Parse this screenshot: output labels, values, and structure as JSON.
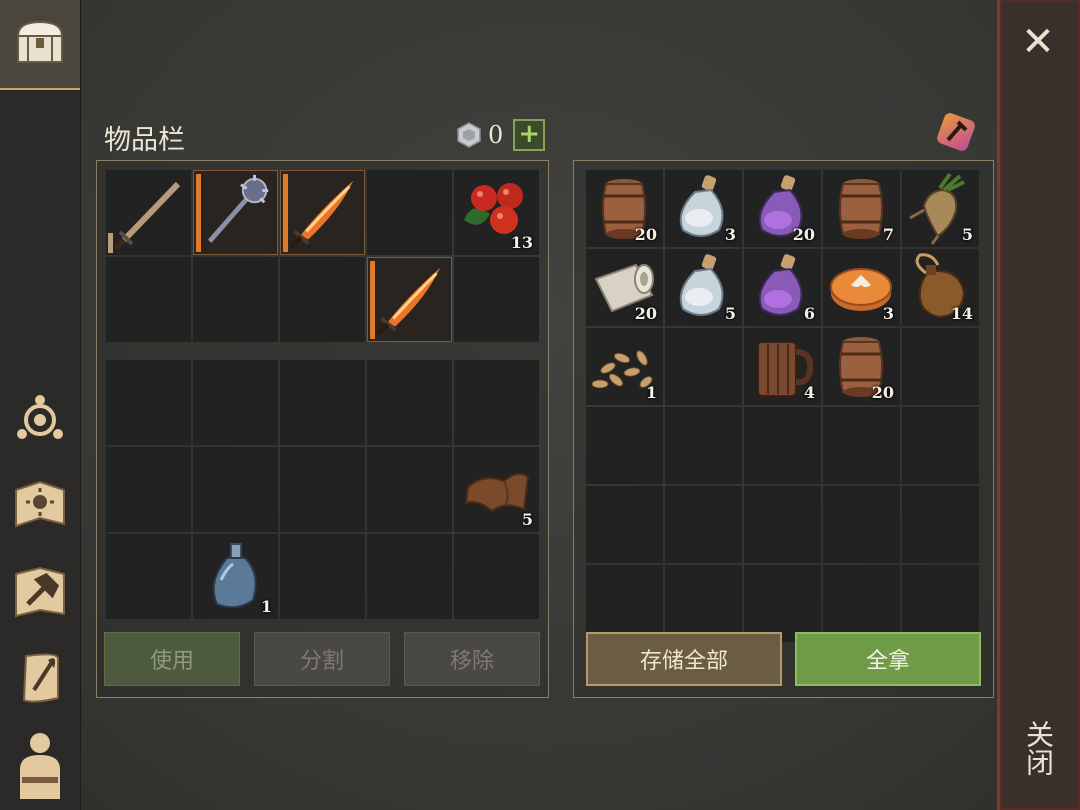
{
  "sidebar": {
    "items": [
      {
        "icon": "chest-icon"
      },
      {
        "icon": "skills-icon"
      },
      {
        "icon": "map-icon"
      },
      {
        "icon": "crafting-icon"
      },
      {
        "icon": "quest-scroll-icon"
      },
      {
        "icon": "character-icon"
      }
    ]
  },
  "close": {
    "label": "关闭",
    "x": "✕"
  },
  "inventory": {
    "title": "物品栏",
    "currency_value": "0",
    "plus_label": "+",
    "equipped": [
      {
        "item": "sword-wood",
        "count": ""
      },
      {
        "item": "mace-steel",
        "count": ""
      },
      {
        "item": "sword-flame",
        "count": ""
      },
      {
        "item": "",
        "count": ""
      },
      {
        "item": "berries",
        "count": "13"
      },
      {
        "item": "",
        "count": ""
      },
      {
        "item": "",
        "count": ""
      },
      {
        "item": "",
        "count": ""
      },
      {
        "item": "sword-flame",
        "count": ""
      },
      {
        "item": "",
        "count": ""
      }
    ],
    "backpack": [
      {
        "item": "",
        "count": ""
      },
      {
        "item": "",
        "count": ""
      },
      {
        "item": "",
        "count": ""
      },
      {
        "item": "",
        "count": ""
      },
      {
        "item": "",
        "count": ""
      },
      {
        "item": "",
        "count": ""
      },
      {
        "item": "",
        "count": ""
      },
      {
        "item": "",
        "count": ""
      },
      {
        "item": "",
        "count": ""
      },
      {
        "item": "leather",
        "count": "5"
      },
      {
        "item": "",
        "count": ""
      },
      {
        "item": "bottle-empty",
        "count": "1"
      },
      {
        "item": "",
        "count": ""
      },
      {
        "item": "",
        "count": ""
      },
      {
        "item": "",
        "count": ""
      }
    ],
    "buttons": {
      "use": "使用",
      "split": "分割",
      "remove": "移除"
    }
  },
  "container": {
    "slots": [
      {
        "item": "barrel",
        "count": "20"
      },
      {
        "item": "potion-white",
        "count": "3"
      },
      {
        "item": "potion-purple",
        "count": "20"
      },
      {
        "item": "barrel",
        "count": "7"
      },
      {
        "item": "root",
        "count": "5"
      },
      {
        "item": "cloth-roll",
        "count": "20"
      },
      {
        "item": "potion-white",
        "count": "5"
      },
      {
        "item": "potion-purple",
        "count": "6"
      },
      {
        "item": "pie",
        "count": "3"
      },
      {
        "item": "waterskin",
        "count": "14"
      },
      {
        "item": "seeds",
        "count": "1"
      },
      {
        "item": "",
        "count": ""
      },
      {
        "item": "mug",
        "count": "4"
      },
      {
        "item": "barrel",
        "count": "20"
      },
      {
        "item": "",
        "count": ""
      },
      {
        "item": "",
        "count": ""
      },
      {
        "item": "",
        "count": ""
      },
      {
        "item": "",
        "count": ""
      },
      {
        "item": "",
        "count": ""
      },
      {
        "item": "",
        "count": ""
      },
      {
        "item": "",
        "count": ""
      },
      {
        "item": "",
        "count": ""
      },
      {
        "item": "",
        "count": ""
      },
      {
        "item": "",
        "count": ""
      },
      {
        "item": "",
        "count": ""
      },
      {
        "item": "",
        "count": ""
      },
      {
        "item": "",
        "count": ""
      },
      {
        "item": "",
        "count": ""
      },
      {
        "item": "",
        "count": ""
      },
      {
        "item": "",
        "count": ""
      }
    ],
    "buttons": {
      "store_all": "存储全部",
      "take_all": "全拿"
    }
  }
}
